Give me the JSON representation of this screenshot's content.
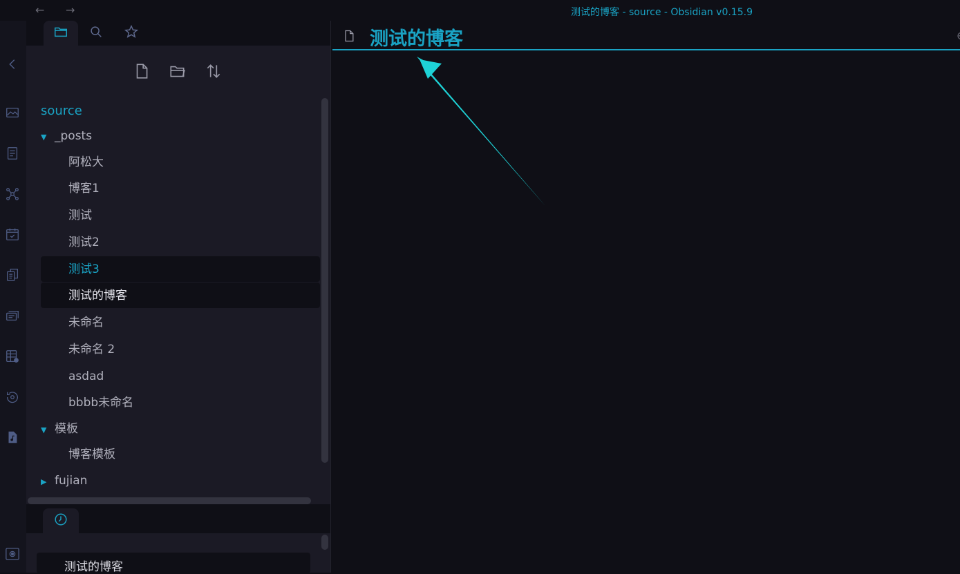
{
  "window": {
    "title": "测试的博客 - source - Obsidian v0.15.9",
    "back_arrow": "←",
    "forward_arrow": "→"
  },
  "ribbon_icons": [
    "collapse-chevron-icon",
    "image-icon",
    "document-list-icon",
    "graph-view-icon",
    "calendar-check-icon",
    "copy-documents-icon",
    "slides-icon",
    "table-settings-icon",
    "history-icon",
    "audio-file-icon",
    "settings-icon"
  ],
  "sidebar": {
    "tabs": [
      "folder-icon",
      "search-icon",
      "star-icon"
    ],
    "actions": [
      "new-note-icon",
      "new-folder-icon",
      "sort-icon"
    ],
    "vault_name": "source",
    "tree": [
      {
        "type": "folder",
        "label": "_posts",
        "expanded": true
      },
      {
        "type": "file",
        "label": "阿松大"
      },
      {
        "type": "file",
        "label": "博客1"
      },
      {
        "type": "file",
        "label": "测试"
      },
      {
        "type": "file",
        "label": "测试2"
      },
      {
        "type": "file",
        "label": "测试3",
        "state": "hovered"
      },
      {
        "type": "file",
        "label": "测试的博客",
        "state": "active"
      },
      {
        "type": "file",
        "label": "未命名"
      },
      {
        "type": "file",
        "label": "未命名 2"
      },
      {
        "type": "file",
        "label": "asdad"
      },
      {
        "type": "file",
        "label": "bbbb未命名"
      },
      {
        "type": "folder",
        "label": "模板",
        "expanded": true
      },
      {
        "type": "file",
        "label": "博客模板"
      },
      {
        "type": "folder",
        "label": "fujian",
        "expanded": false
      }
    ]
  },
  "recent_panel": {
    "tab_icon": "clock-icon",
    "items": [
      "测试的博客"
    ]
  },
  "editor": {
    "tab_icon": "document-icon",
    "note_title": "测试的博客",
    "right_edge_glyph": "⊖"
  },
  "colors": {
    "accent": "#1aa3c4",
    "annotation_arrow": "#1ed2d6",
    "background": "#0f0f16",
    "sidebar_background": "#1b1a25"
  }
}
